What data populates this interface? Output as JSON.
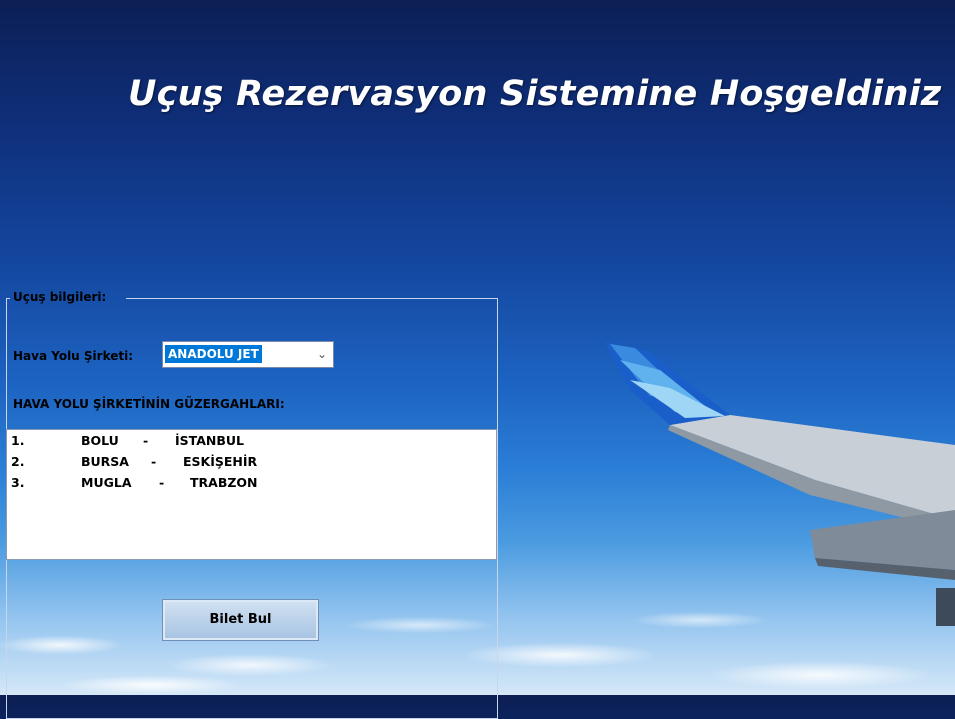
{
  "window": {
    "title": "Uçuş Rezervasyon Sistemine Hoşgeldiniz"
  },
  "flight_info": {
    "legend": "Uçuş bilgileri:",
    "airline_label": "Hava Yolu Şirketi:",
    "airline_selected": "ANADOLU JET",
    "routes_header": "HAVA YOLU ŞİRKETİNİN GÜZERGAHLARI:",
    "routes": [
      {
        "no": "1.",
        "from": "BOLU",
        "sep": "-",
        "to": "İSTANBUL"
      },
      {
        "no": "2.",
        "from": "BURSA",
        "sep": "-",
        "to": "ESKİŞEHİR"
      },
      {
        "no": "3.",
        "from": "MUGLA",
        "sep": "-",
        "to": "TRABZON"
      }
    ],
    "find_ticket_label": "Bilet Bul"
  },
  "icons": {
    "combo_arrow": "chevron-down-icon"
  },
  "colors": {
    "selection": "#0078d7",
    "sky_top": "#0c1f55",
    "sky_bottom": "#d5e8f8"
  }
}
